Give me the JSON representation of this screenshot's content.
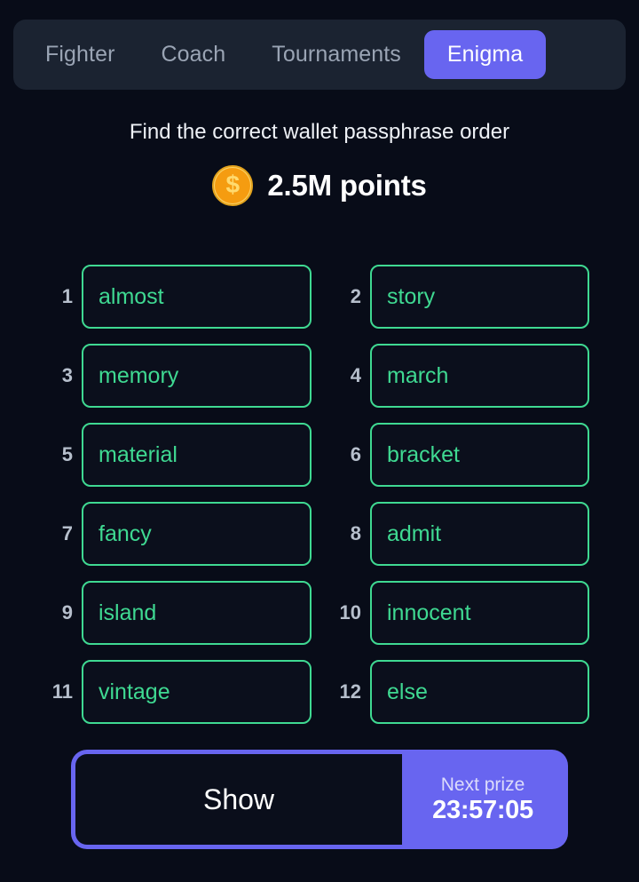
{
  "tabs": [
    {
      "label": "Fighter",
      "active": false
    },
    {
      "label": "Coach",
      "active": false
    },
    {
      "label": "Tournaments",
      "active": false
    },
    {
      "label": "Enigma",
      "active": true
    }
  ],
  "header": {
    "subtitle": "Find the correct wallet passphrase order",
    "coin_icon": "coin-icon",
    "coin_symbol": "$",
    "points": "2.5M points"
  },
  "grid": {
    "entries": [
      {
        "index": "1",
        "word": "almost"
      },
      {
        "index": "2",
        "word": "story"
      },
      {
        "index": "3",
        "word": "memory"
      },
      {
        "index": "4",
        "word": "march"
      },
      {
        "index": "5",
        "word": "material"
      },
      {
        "index": "6",
        "word": "bracket"
      },
      {
        "index": "7",
        "word": "fancy"
      },
      {
        "index": "8",
        "word": "admit"
      },
      {
        "index": "9",
        "word": "island"
      },
      {
        "index": "10",
        "word": "innocent"
      },
      {
        "index": "11",
        "word": "vintage"
      },
      {
        "index": "12",
        "word": "else"
      }
    ]
  },
  "action_bar": {
    "show_label": "Show",
    "prize_label": "Next prize",
    "prize_timer": "23:57:05"
  },
  "colors": {
    "background": "#080c18",
    "tabbar_background": "#1b2331",
    "accent_purple": "#6865f0",
    "word_green": "#3fd992",
    "text_light": "#eef1f6",
    "text_muted": "#9aa4b4",
    "coin_gold": "#f59c10"
  }
}
